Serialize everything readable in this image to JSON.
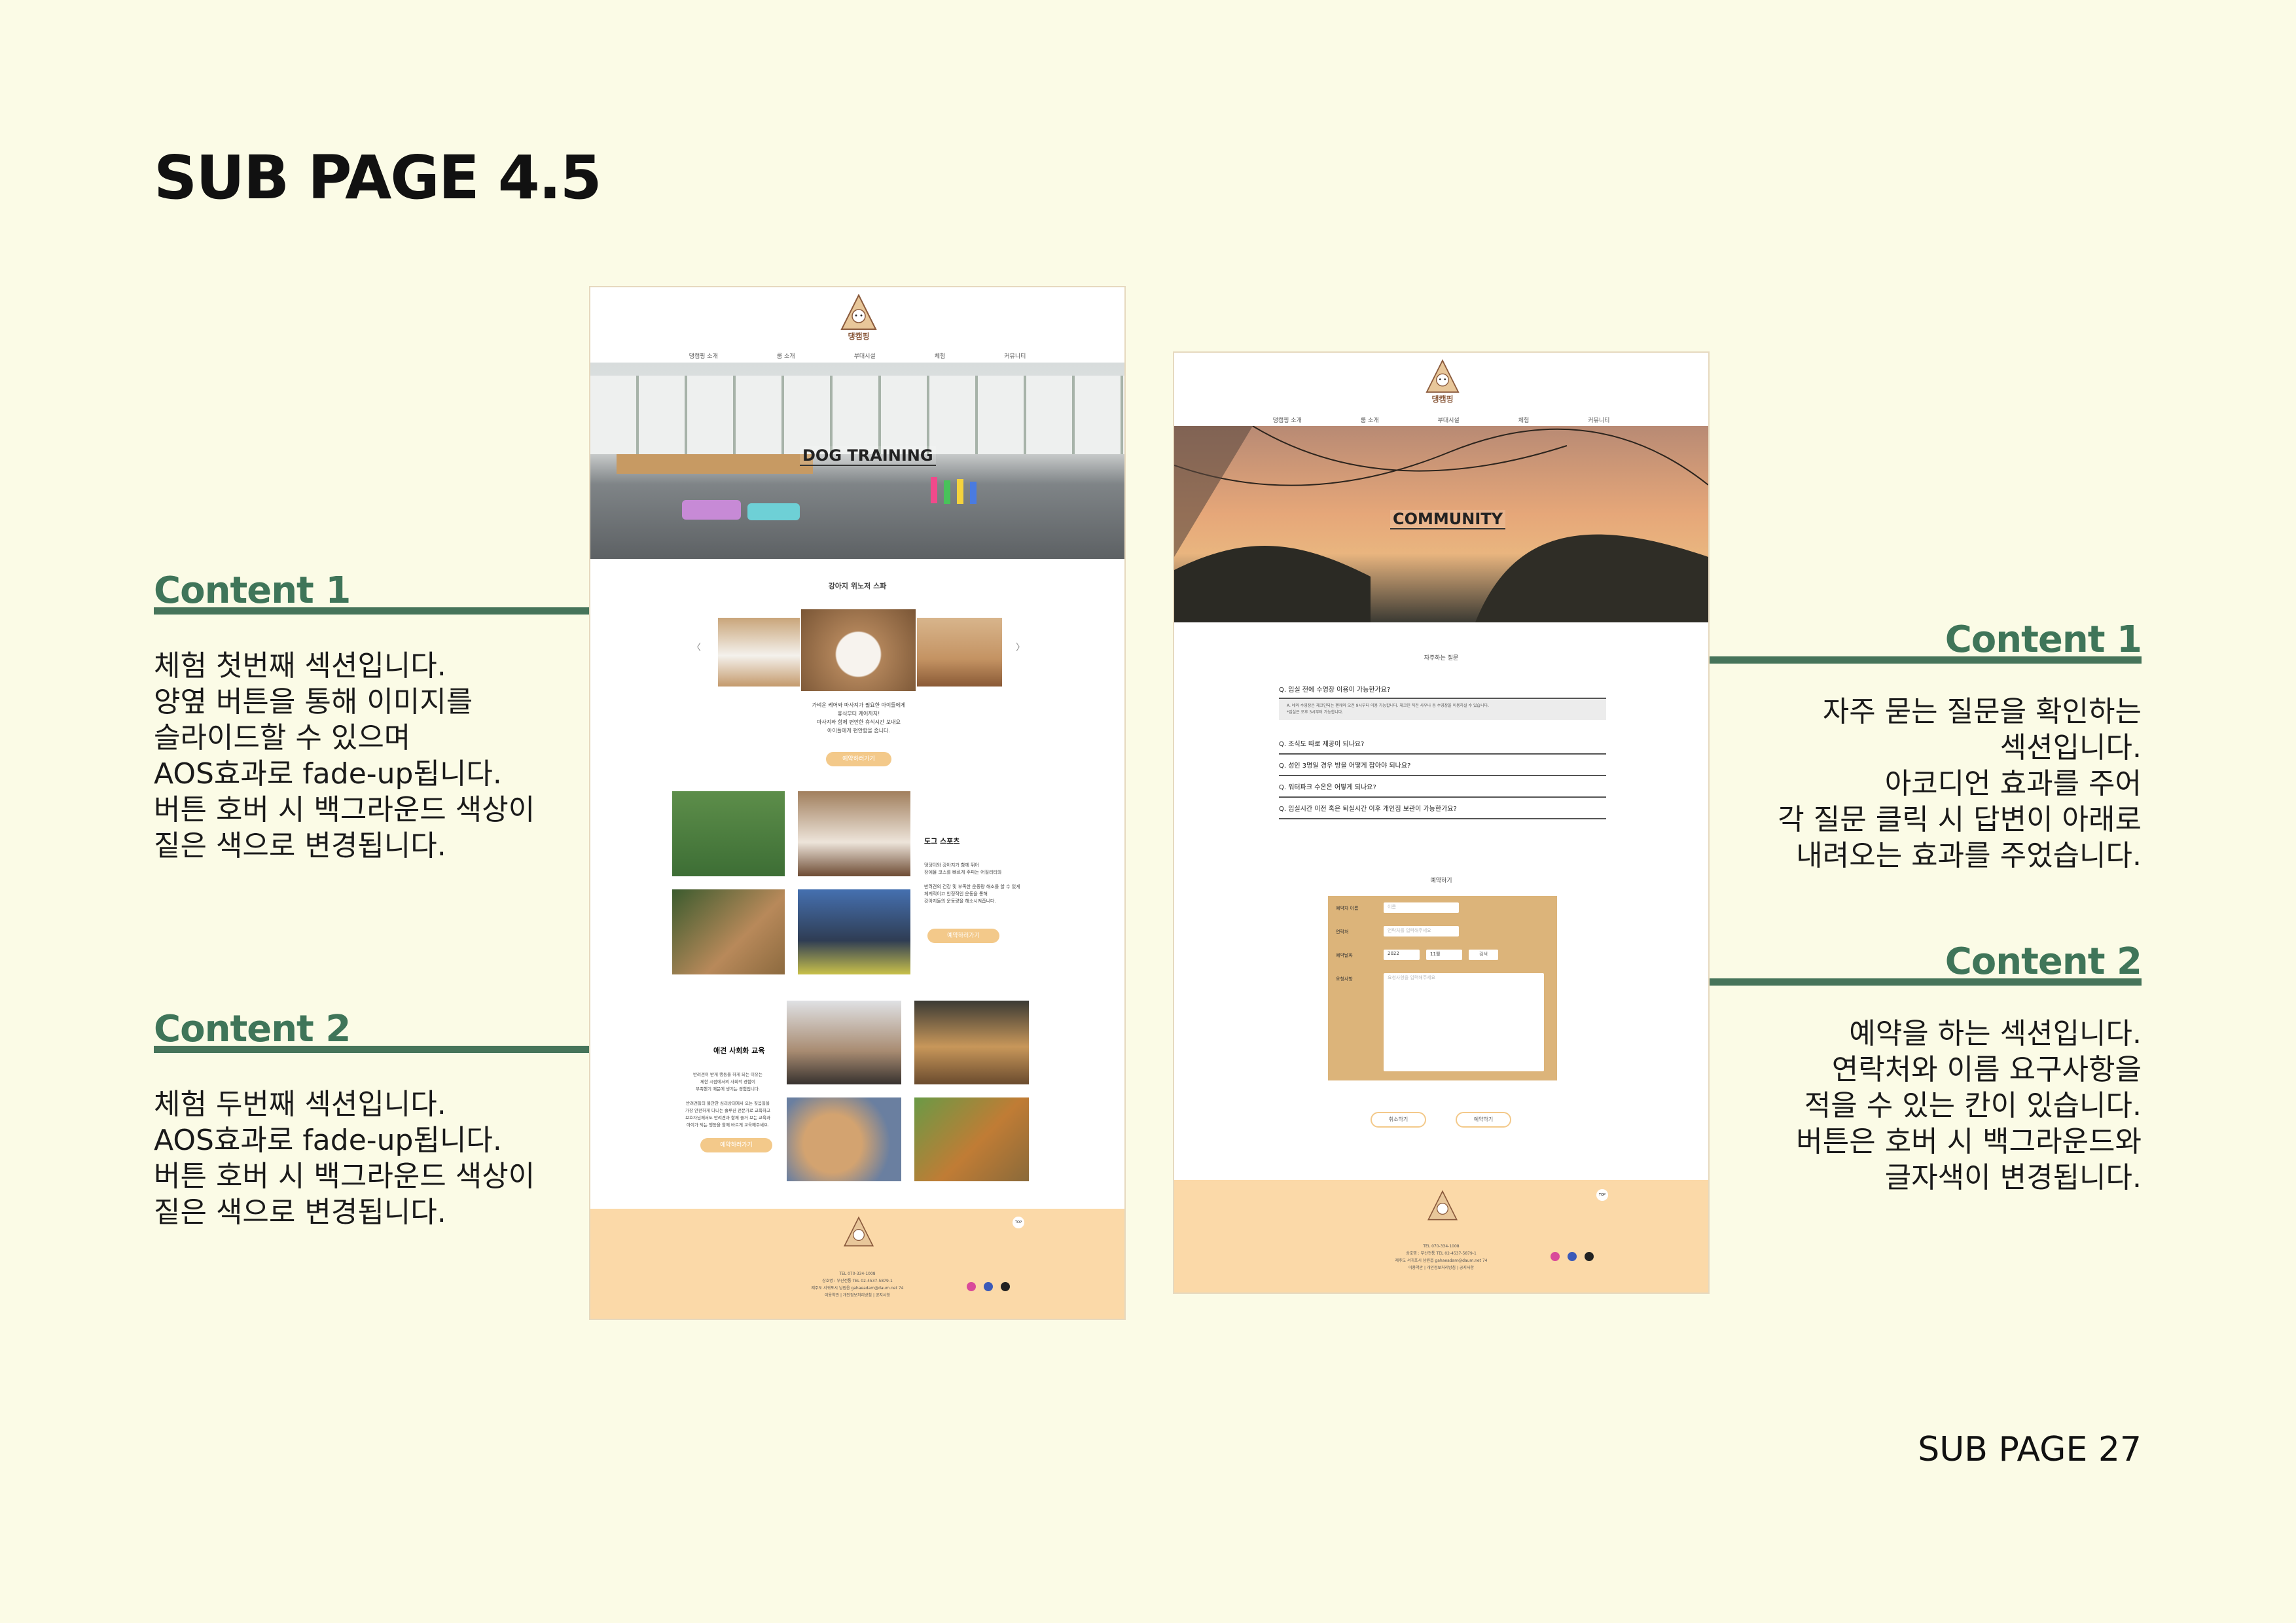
{
  "header": {
    "title": "SUB PAGE 4.5"
  },
  "footer": {
    "page_number": "SUB PAGE 27"
  },
  "left_sections": [
    {
      "title": "Content 1",
      "description": "체험 첫번째 섹션입니다.\n양옆 버튼을 통해 이미지를\n슬라이드할 수 있으며\nAOS효과로 fade-up됩니다.\n버튼 호버 시 백그라운드 색상이\n짙은 색으로 변경됩니다."
    },
    {
      "title": "Content 2",
      "description": "체험 두번째 섹션입니다.\nAOS효과로 fade-up됩니다.\n버튼 호버 시 백그라운드 색상이\n짙은 색으로 변경됩니다."
    }
  ],
  "right_sections": [
    {
      "title": "Content 1",
      "description": "자주 묻는 질문을 확인하는\n섹션입니다.\n아코디언 효과를 주어\n각 질문 클릭 시 답변이 아래로\n내려오는 효과를 주었습니다."
    },
    {
      "title": "Content 2",
      "description": "예약을 하는 섹션입니다.\n연락처와 이름 요구사항을\n적을 수 있는 칸이 있습니다.\n버튼은 호버 시 백그라운드와\n글자색이 변경됩니다."
    }
  ],
  "mock_left": {
    "brand": "댕캠핑",
    "nav": [
      "댕캠핑 소개",
      "룸 소개",
      "부대시설",
      "체험",
      "커뮤니티"
    ],
    "hero_label": "DOG TRAINING",
    "slider_title": "강아지 위노저 스파",
    "prev_arrow": "〈",
    "next_arrow": "〉",
    "slider_text": "가벼운 케어와 마사지가 필요한 아이들에게\n휴식부터 케어까지!\n마사지와 함께 편안한 휴식시간 보내요\n아이들에게 편안함을 줍니다.",
    "slider_btn": "예약하러가기",
    "sport_title": "도그 스포츠",
    "sport_text": "댕댕이와 강아지가 함께 뛰어\n장애물 코스를 빠르게 주파는 어질리티와\n\n반려견의 건강 및 부족한 운동량 해소를 할 수 있게\n체계적이고 안정적인 운동을 통해\n강아지들의 운동량을 해소시켜줍니다.",
    "sport_btn": "예약하러가기",
    "social_title": "애견 사회화 교육",
    "social_text": "반려견이 받게 행동을 하게 되는 이유는\n제한 시점에서의 사회적 경험이\n부족했기 때문에 생기는 경험입니다.\n\n반려견들의 불안한 심리상태에서 오는 짖음들을\n가장 안전하게 다니는 솔루션 전문가로 교육하고\n보호자님께서도 반려견과 함께 즐거 보는 교육과\n아이가 되는 행동을 할께 바르게 교육해주세요.",
    "social_btn": "예약하러가기",
    "footer_lines": [
      "TEL 070-334-1008",
      "상호명 : 부산전통 TEL 02-4537-5879-1",
      "제주도 서귀포시 남원읍 gahaeadam@daum.net 74",
      "이용약관 | 개인정보처리방침 | 공지사항"
    ],
    "top_btn": "TOP"
  },
  "mock_right": {
    "brand": "댕캠핑",
    "nav": [
      "댕캠핑 소개",
      "룸 소개",
      "부대시설",
      "체험",
      "커뮤니티"
    ],
    "hero_label": "COMMUNITY",
    "faq_title": "자주하는 질문",
    "faq": [
      "Q. 입실 전에 수영장 이용이 가능한가요?",
      "Q. 조식도 따로 제공이 되나요?",
      "Q. 성인 3명일 경우 방을 어떻게 잡아야 되나요?",
      "Q. 워터파크 수온은 어떻게 되나요?",
      "Q. 입실시간 이전 혹은 퇴실시간 이후 개인짐 보관이 가능한가요?"
    ],
    "faq_answer": "A. 네와 수영장은 체크인되는 펜캐와 오전 9시부터 이용 가능합니다. 체크인 직전 사우나 등 수영장을 이용하실 수 있습니다.\n*입실은 오후 3시부터 가능합니다.",
    "reserve_title": "예약하기",
    "form": {
      "name_label": "예약자 이름",
      "name_placeholder": "이름",
      "phone_label": "연락처",
      "phone_placeholder": "연락처를 입력해주세요",
      "date_label": "예약날짜",
      "year": "2022",
      "month": "11월",
      "day_btn": "검색",
      "request_label": "요청사항",
      "request_placeholder": "요청사항을 입력해주세요"
    },
    "cancel_btn": "취소하기",
    "submit_btn": "예약하기",
    "footer_lines": [
      "TEL 070-334-1008",
      "상호명 : 부산전통 TEL 02-4537-5879-1",
      "제주도 서귀포시 남원읍 gahaeadam@daum.net 74",
      "이용약관 | 개인정보처리방침 | 공지사항"
    ],
    "top_btn": "TOP"
  },
  "colors": {
    "background": "#fbfbe6",
    "accent_green": "#46745a",
    "accent_peach": "#f3c98a",
    "footer_peach": "#fbd9a8",
    "form_tan": "#dcb47a"
  }
}
